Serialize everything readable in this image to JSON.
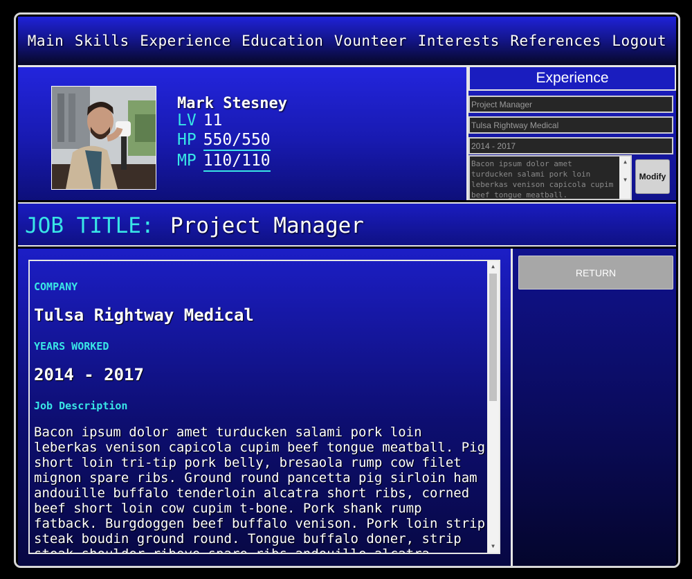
{
  "nav": {
    "items": [
      "Main",
      "Skills",
      "Experience",
      "Education",
      "Vounteer",
      "Interests",
      "References",
      "Logout"
    ]
  },
  "profile": {
    "name": "Mark Stesney",
    "lv_label": "LV",
    "lv_value": "11",
    "hp_label": "HP",
    "hp_value": "550/550",
    "mp_label": "MP",
    "mp_value": "110/110"
  },
  "experience_form": {
    "header": "Experience",
    "title_value": "Project Manager",
    "company_value": "Tulsa Rightway Medical",
    "years_value": "2014 - 2017",
    "description_value": "Bacon ipsum dolor amet turducken salami pork loin leberkas venison capicola cupim beef tongue meatball.",
    "modify_label": "Modify"
  },
  "job": {
    "label": "JOB TITLE:",
    "title": "Project Manager"
  },
  "detail": {
    "company_label": "COMPANY",
    "company": "Tulsa Rightway Medical",
    "years_label": "YEARS WORKED",
    "years": "2014 - 2017",
    "desc_label": "Job Description",
    "description": "Bacon ipsum dolor amet turducken salami pork loin leberkas venison capicola cupim beef tongue meatball. Pig short loin tri-tip pork belly, bresaola rump cow filet mignon spare ribs. Ground round pancetta pig sirloin ham andouille buffalo tenderloin alcatra short ribs, corned beef short loin cow cupim t-bone. Pork shank rump fatback. Burgdoggen beef buffalo venison. Pork loin strip steak boudin ground round. Tongue buffalo doner, strip steak shoulder ribeye spare ribs andouille alcatra brisket."
  },
  "side": {
    "return_label": "RETURN"
  },
  "colors": {
    "accent": "#39e6e6",
    "panel_blue": "#1a1cbf",
    "border": "#e6e6e6"
  }
}
